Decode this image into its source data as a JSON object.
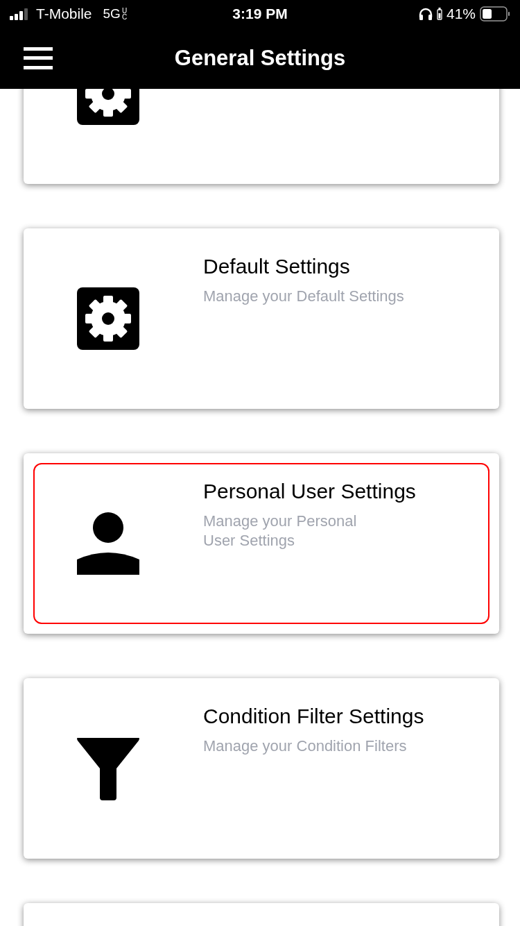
{
  "status_bar": {
    "carrier": "T-Mobile",
    "network": "5G",
    "network_badge": "UC",
    "time": "3:19 PM",
    "battery_percent": "41%"
  },
  "header": {
    "title": "General Settings"
  },
  "cards": [
    {
      "kind": "gear",
      "selected": false
    },
    {
      "kind": "gear",
      "title": "Default Settings",
      "subtitle": "Manage your Default Settings",
      "selected": false
    },
    {
      "kind": "person",
      "title": "Personal User Settings",
      "subtitle": "Manage your Personal\nUser Settings",
      "selected": true
    },
    {
      "kind": "filter",
      "title": "Condition Filter Settings",
      "subtitle": "Manage your Condition Filters",
      "selected": false
    },
    {
      "selected": false
    }
  ]
}
